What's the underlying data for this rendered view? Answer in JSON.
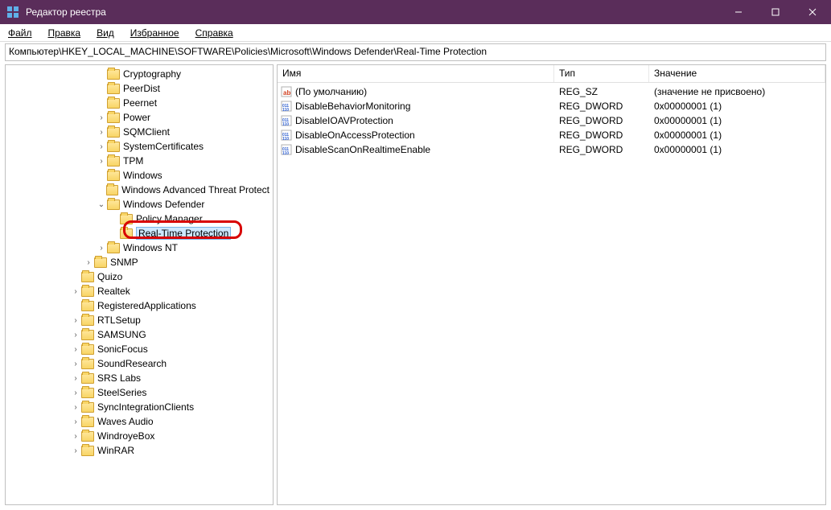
{
  "window": {
    "title": "Редактор реестра"
  },
  "menu": {
    "file": "Файл",
    "edit": "Правка",
    "view": "Вид",
    "favorites": "Избранное",
    "help": "Справка"
  },
  "address": "Компьютер\\HKEY_LOCAL_MACHINE\\SOFTWARE\\Policies\\Microsoft\\Windows Defender\\Real-Time Protection",
  "tree": [
    {
      "indent": 7,
      "exp": "",
      "label": "Cryptography"
    },
    {
      "indent": 7,
      "exp": "",
      "label": "PeerDist"
    },
    {
      "indent": 7,
      "exp": "",
      "label": "Peernet"
    },
    {
      "indent": 7,
      "exp": ">",
      "label": "Power"
    },
    {
      "indent": 7,
      "exp": ">",
      "label": "SQMClient"
    },
    {
      "indent": 7,
      "exp": ">",
      "label": "SystemCertificates"
    },
    {
      "indent": 7,
      "exp": ">",
      "label": "TPM"
    },
    {
      "indent": 7,
      "exp": "",
      "label": "Windows"
    },
    {
      "indent": 7,
      "exp": "",
      "label": "Windows Advanced Threat Protect"
    },
    {
      "indent": 7,
      "exp": "v",
      "label": "Windows Defender"
    },
    {
      "indent": 8,
      "exp": "",
      "label": "Policy Manager"
    },
    {
      "indent": 8,
      "exp": "",
      "label": "Real-Time Protection",
      "selected": true
    },
    {
      "indent": 7,
      "exp": ">",
      "label": "Windows NT"
    },
    {
      "indent": 6,
      "exp": ">",
      "label": "SNMP"
    },
    {
      "indent": 5,
      "exp": "",
      "label": "Quizo"
    },
    {
      "indent": 5,
      "exp": ">",
      "label": "Realtek"
    },
    {
      "indent": 5,
      "exp": "",
      "label": "RegisteredApplications"
    },
    {
      "indent": 5,
      "exp": ">",
      "label": "RTLSetup"
    },
    {
      "indent": 5,
      "exp": ">",
      "label": "SAMSUNG"
    },
    {
      "indent": 5,
      "exp": ">",
      "label": "SonicFocus"
    },
    {
      "indent": 5,
      "exp": ">",
      "label": "SoundResearch"
    },
    {
      "indent": 5,
      "exp": ">",
      "label": "SRS Labs"
    },
    {
      "indent": 5,
      "exp": ">",
      "label": "SteelSeries"
    },
    {
      "indent": 5,
      "exp": ">",
      "label": "SyncIntegrationClients"
    },
    {
      "indent": 5,
      "exp": ">",
      "label": "Waves Audio"
    },
    {
      "indent": 5,
      "exp": ">",
      "label": "WindroyeBox"
    },
    {
      "indent": 5,
      "exp": ">",
      "label": "WinRAR"
    }
  ],
  "list": {
    "headers": {
      "name": "Имя",
      "type": "Тип",
      "value": "Значение"
    },
    "rows": [
      {
        "icon": "string",
        "name": "(По умолчанию)",
        "type": "REG_SZ",
        "value": "(значение не присвоено)"
      },
      {
        "icon": "dword",
        "name": "DisableBehaviorMonitoring",
        "type": "REG_DWORD",
        "value": "0x00000001 (1)"
      },
      {
        "icon": "dword",
        "name": "DisableIOAVProtection",
        "type": "REG_DWORD",
        "value": "0x00000001 (1)"
      },
      {
        "icon": "dword",
        "name": "DisableOnAccessProtection",
        "type": "REG_DWORD",
        "value": "0x00000001 (1)"
      },
      {
        "icon": "dword",
        "name": "DisableScanOnRealtimeEnable",
        "type": "REG_DWORD",
        "value": "0x00000001 (1)"
      }
    ]
  }
}
